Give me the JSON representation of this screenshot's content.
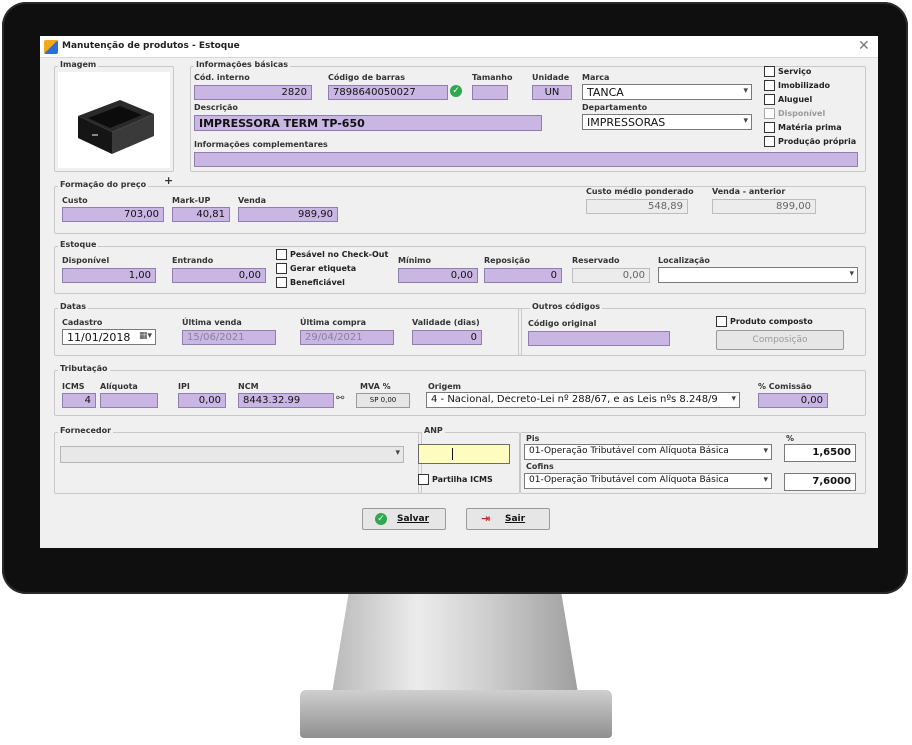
{
  "window": {
    "title": "Manutenção de produtos - Estoque",
    "close": "✕"
  },
  "imagem": {
    "label": "Imagem"
  },
  "info": {
    "group_label": "Informações básicas",
    "cod_interno_label": "Cód. interno",
    "cod_interno": "2820",
    "barras_label": "Código de barras",
    "barras": "7898640050027",
    "tamanho_label": "Tamanho",
    "tamanho": "",
    "unidade_label": "Unidade",
    "unidade": "UN",
    "marca_label": "Marca",
    "marca": "TANCA",
    "descricao_label": "Descrição",
    "descricao": "IMPRESSORA TERM TP-650",
    "departamento_label": "Departamento",
    "departamento": "IMPRESSORAS",
    "complementares_label": "Informações complementares",
    "complementares": ""
  },
  "flags": [
    {
      "label": "Serviço",
      "disabled": false
    },
    {
      "label": "Imobilizado",
      "disabled": false
    },
    {
      "label": "Aluguel",
      "disabled": false
    },
    {
      "label": "Disponível",
      "disabled": true
    },
    {
      "label": "Matéria prima",
      "disabled": false
    },
    {
      "label": "Produção própria",
      "disabled": false
    }
  ],
  "preco": {
    "group_label": "Formação do preço",
    "plus": "+",
    "custo_label": "Custo",
    "custo": "703,00",
    "markup_label": "Mark-UP",
    "markup": "40,81",
    "venda_label": "Venda",
    "venda": "989,90",
    "custo_medio_label": "Custo médio ponderado",
    "custo_medio": "548,89",
    "venda_anterior_label": "Venda - anterior",
    "venda_anterior": "899,00"
  },
  "estoque": {
    "group_label": "Estoque",
    "disponivel_label": "Disponível",
    "disponivel": "1,00",
    "entrando_label": "Entrando",
    "entrando": "0,00",
    "chk_pesavel": "Pesável no Check-Out",
    "chk_etiqueta": "Gerar etiqueta",
    "chk_beneficiavel": "Beneficiável",
    "minimo_label": "Mínimo",
    "minimo": "0,00",
    "reposicao_label": "Reposição",
    "reposicao": "0",
    "reservado_label": "Reservado",
    "reservado": "0,00",
    "localizacao_label": "Localização",
    "localizacao": ""
  },
  "datas": {
    "group_label": "Datas",
    "cadastro_label": "Cadastro",
    "cadastro": "11/01/2018",
    "ultima_venda_label": "Última venda",
    "ultima_venda": "15/06/2021",
    "ultima_compra_label": "Última compra",
    "ultima_compra": "29/04/2021",
    "validade_label": "Validade (dias)",
    "validade": "0"
  },
  "outros": {
    "group_label": "Outros códigos",
    "codigo_original_label": "Código original",
    "codigo_original": "",
    "produto_composto_label": "Produto composto",
    "composicao_label": "Composição"
  },
  "tributacao": {
    "group_label": "Tributação",
    "icms_label": "ICMS",
    "icms": "4",
    "aliquota_label": "Alíquota",
    "aliquota": "",
    "ipi_label": "IPI",
    "ipi": "0,00",
    "ncm_label": "NCM",
    "ncm": "8443.32.99",
    "mva_label": "MVA %",
    "mva": "SP 0,00",
    "origem_label": "Origem",
    "origem": "4 - Nacional, Decreto-Lei nº 288/67, e as Leis nºs 8.248/9",
    "comissao_label": "% Comissão",
    "comissao": "0,00"
  },
  "bottom": {
    "fornecedor_label": "Fornecedor",
    "fornecedor": "",
    "anp_label": "ANP",
    "anp": "",
    "partilha_label": "Partilha ICMS",
    "pis_label": "Pis",
    "pis": "01-Operação Tributável com Alíquota Básica",
    "cofins_label": "Cofins",
    "cofins": "01-Operação Tributável com Alíquota Básica",
    "pct_label": "%",
    "pis_pct": "1,6500",
    "cofins_pct": "7,6000"
  },
  "buttons": {
    "salvar": "Salvar",
    "sair": "Sair"
  },
  "colors": {
    "field": "#c9b6e3",
    "anp": "#fffcc0",
    "check": "#2fa84f"
  }
}
